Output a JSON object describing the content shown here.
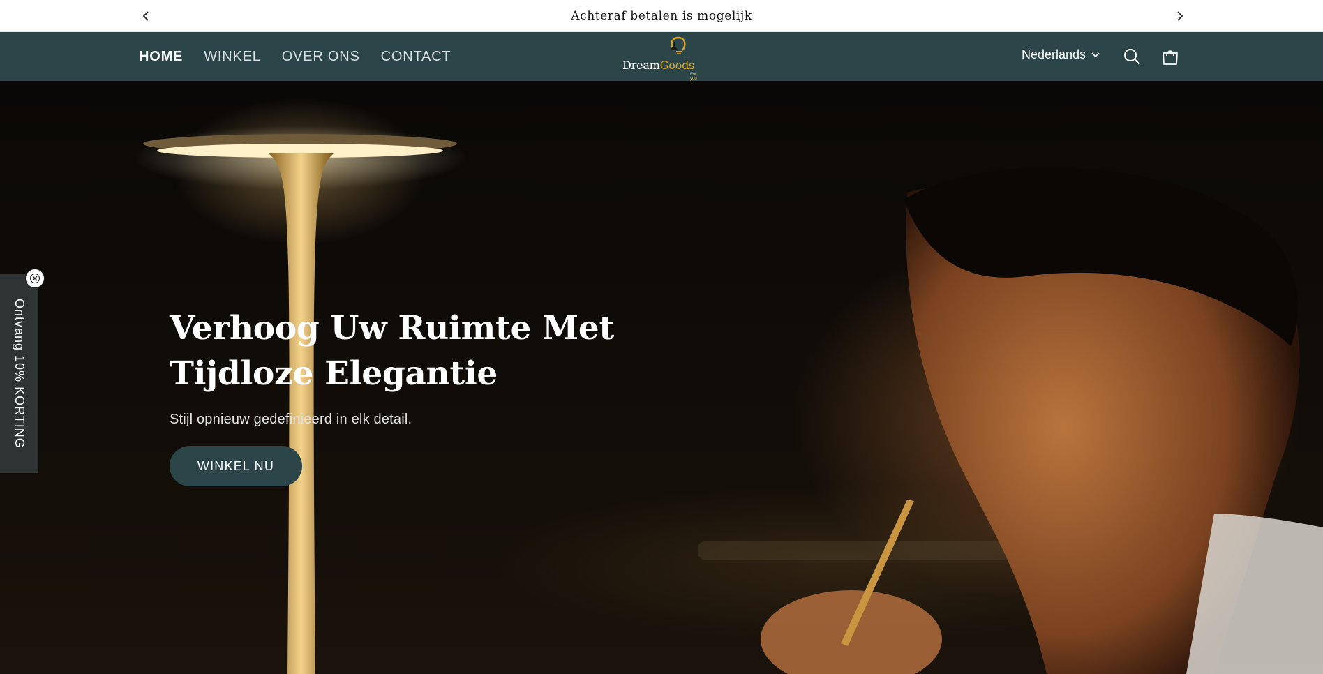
{
  "announcement": {
    "text": "Achteraf betalen is mogelijk",
    "prev_icon": "chevron-left-icon",
    "next_icon": "chevron-right-icon"
  },
  "header": {
    "nav": [
      {
        "label": "HOME",
        "active": true
      },
      {
        "label": "WINKEL",
        "active": false
      },
      {
        "label": "OVER ONS",
        "active": false
      },
      {
        "label": "CONTACT",
        "active": false
      }
    ],
    "logo": {
      "part1": "Dream",
      "part2": "Goods",
      "tagline": "For you"
    },
    "language": "Nederlands",
    "icons": [
      "search-icon",
      "cart-icon"
    ]
  },
  "hero": {
    "title": "Verhoog Uw Ruimte Met Tijdloze Elegantie",
    "subtitle": "Stijl opnieuw gedefinieerd in elk detail.",
    "button_label": "WINKEL NU"
  },
  "discount_tab": {
    "label": "Ontvang 10% KORTING"
  },
  "colors": {
    "header_bg": "#2c4549",
    "button_bg": "#2c4549",
    "logo_accent": "#d9a520",
    "announcement_bg": "#ffffff",
    "discount_tab_bg": "#2e3434"
  }
}
